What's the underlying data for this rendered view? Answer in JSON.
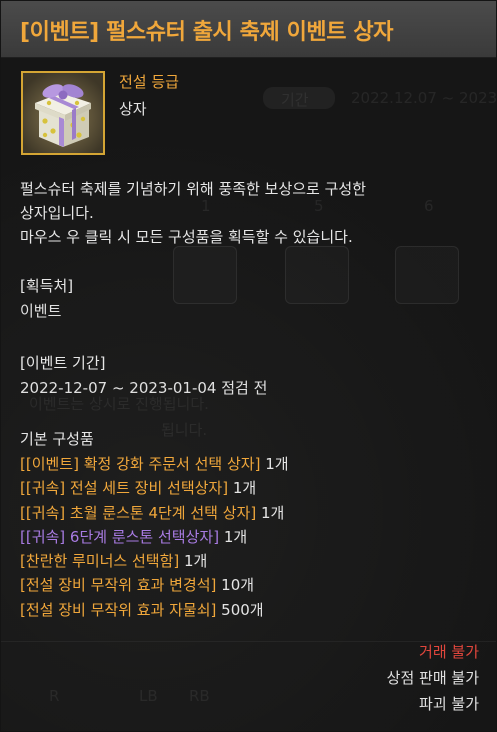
{
  "item": {
    "title": "[이벤트] 펄스슈터 출시 축제 이벤트 상자",
    "grade": "전설 등급",
    "type": "상자",
    "description": [
      "펄스슈터 축제를 기념하기 위해 풍족한 보상으로 구성한",
      "상자입니다.",
      "마우스 우 클릭 시 모든 구성품을 획득할 수 있습니다."
    ],
    "icon": "gift-box-icon"
  },
  "source": {
    "heading": "[획득처]",
    "value": "이벤트"
  },
  "period": {
    "heading": "[이벤트 기간]",
    "value": "2022-12-07 ~ 2023-01-04 점검 전"
  },
  "contents": {
    "heading": "기본 구성품",
    "items": [
      {
        "name": "[[이벤트] 확정 강화 주문서 선택 상자]",
        "qty": " 1개",
        "color": "#f0a73b"
      },
      {
        "name": "[[귀속] 전설 세트 장비 선택상자]",
        "qty": " 1개",
        "color": "#f0a73b"
      },
      {
        "name": "[[귀속] 초월 룬스톤 4단계 선택 상자]",
        "qty": " 1개",
        "color": "#f0a73b"
      },
      {
        "name": "[[귀속] 6단계 룬스톤 선택상자]",
        "qty": " 1개",
        "color": "#a87be2"
      },
      {
        "name": "[찬란한 루미너스 선택함]",
        "qty": " 1개",
        "color": "#f0a73b"
      },
      {
        "name": "[전설 장비 무작위 효과 변경석]",
        "qty": " 10개",
        "color": "#f0a73b"
      },
      {
        "name": "[전설 장비 무작위 효과 자물쇠]",
        "qty": " 500개",
        "color": "#f0a73b"
      }
    ]
  },
  "restrictions": {
    "trade": "거래 불가",
    "shop_sell": "상점 판매 불가",
    "destroy": "파괴 불가",
    "trade_color": "#e0463c"
  },
  "background_ghost": {
    "tab_label": "기간",
    "date": "2022.12.07 ~ 2023",
    "slot_numbers": [
      "1",
      "5",
      "6"
    ],
    "notice_1": "이벤트는 상시로 진행됩니다.",
    "notice_2": "됩니다.",
    "controller_buttons": [
      "R",
      "LB",
      "RB"
    ]
  }
}
